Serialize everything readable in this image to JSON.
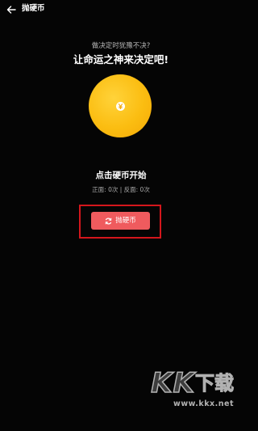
{
  "topbar": {
    "title": "抛硬币",
    "back_icon": "arrow-left-icon"
  },
  "main": {
    "subtitle": "做决定时犹豫不决?",
    "headline": "让命运之神来决定吧!",
    "coin_icon": "yen-icon",
    "coin_color": "#fbbd11",
    "prompt": "点击硬币开始",
    "stats": "正面: 0次 | 反面: 0次",
    "flip_button": {
      "label": "抛硬币",
      "icon": "refresh-icon",
      "color": "#ef5b5e"
    },
    "highlight_color": "#d4161c"
  },
  "watermark": {
    "logo": "KK下载",
    "url": "www.kkx.net"
  }
}
